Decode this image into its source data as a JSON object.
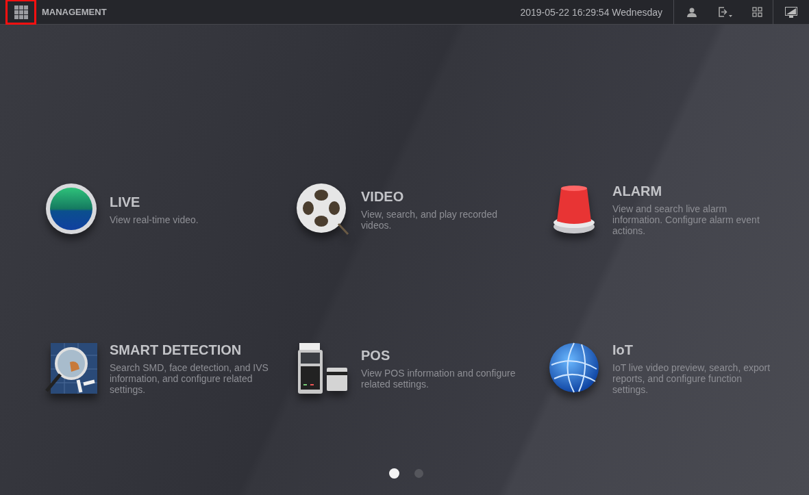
{
  "header": {
    "menu_button": {
      "highlighted": true
    },
    "title": "MANAGEMENT",
    "datetime": "2019-05-22 16:29:54 Wednesday"
  },
  "tiles": [
    {
      "kind": "live",
      "title": "LIVE",
      "description": "View real-time video."
    },
    {
      "kind": "video",
      "title": "VIDEO",
      "description": "View, search, and play recorded videos."
    },
    {
      "kind": "alarm",
      "title": "ALARM",
      "description": "View and search live alarm information. Configure alarm event actions."
    },
    {
      "kind": "smart",
      "title": "SMART DETECTION",
      "description": "Search SMD, face detection, and IVS information, and configure related settings."
    },
    {
      "kind": "pos",
      "title": "POS",
      "description": "View POS information and configure related settings."
    },
    {
      "kind": "iot",
      "title": "IoT",
      "description": "IoT live video preview, search, export reports, and configure function settings."
    }
  ],
  "pages": [
    {
      "selected": true
    },
    {
      "selected": false
    }
  ]
}
